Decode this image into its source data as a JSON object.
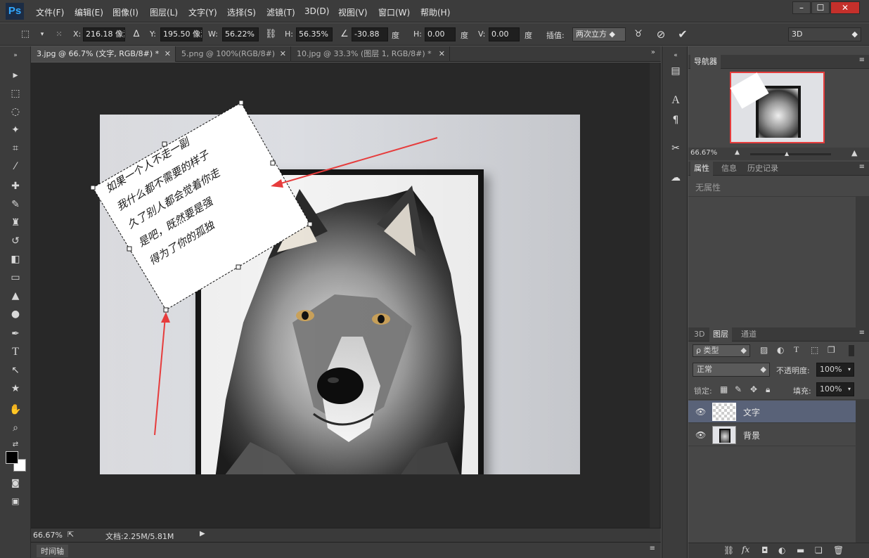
{
  "app": {
    "logo": "Ps"
  },
  "menu": [
    "文件(F)",
    "编辑(E)",
    "图像(I)",
    "图层(L)",
    "文字(Y)",
    "选择(S)",
    "滤镜(T)",
    "3D(D)",
    "视图(V)",
    "窗口(W)",
    "帮助(H)"
  ],
  "window_controls": [
    "–",
    "☐",
    "✕"
  ],
  "options": {
    "x_label": "X:",
    "x_value": "216.18 像素",
    "y_label": "Y:",
    "y_value": "195.50 像素",
    "w_label": "W:",
    "w_value": "56.22%",
    "h_label": "H:",
    "h_value": "56.35%",
    "angle_value": "-30.88",
    "angle_unit": "度",
    "hskew_label": "H:",
    "hskew_value": "0.00",
    "hskew_unit": "度",
    "vskew_label": "V:",
    "vskew_value": "0.00",
    "vskew_unit": "度",
    "interp_label": "插值:",
    "interp_value": "两次立方",
    "workspace": "3D"
  },
  "tabs": [
    {
      "label": "3.jpg @ 66.7% (文字, RGB/8#) *",
      "active": true
    },
    {
      "label": "5.png @ 100%(RGB/8#)",
      "active": false
    },
    {
      "label": "10.jpg @ 33.3% (图层 1, RGB/8#) *",
      "active": false
    }
  ],
  "handwriting": [
    "如果一个人不走一副",
    "我什么都不需要的样子",
    "久了别人都会觉着你走",
    "是吧，既然要是强",
    "得为了你的孤独"
  ],
  "status": {
    "zoom": "66.67%",
    "doc_info": "文档:2.25M/5.81M"
  },
  "timeline_label": "时间轴",
  "navigator": {
    "tab": "导航器",
    "zoom": "66.67%"
  },
  "properties": {
    "tabs": [
      "属性",
      "信息",
      "历史记录"
    ],
    "empty_text": "无属性"
  },
  "layers": {
    "tabs": [
      "3D",
      "图层",
      "通道"
    ],
    "filter": "ρ 类型",
    "blend": "正常",
    "opacity_label": "不透明度:",
    "opacity_value": "100%",
    "lock_label": "锁定:",
    "fill_label": "填充:",
    "fill_value": "100%",
    "items": [
      {
        "name": "文字",
        "selected": true
      },
      {
        "name": "背景",
        "selected": false
      }
    ]
  },
  "colors": {
    "accent_red": "#e63c3c",
    "selected_layer": "#596278",
    "ps_blue": "#31a8ff"
  }
}
